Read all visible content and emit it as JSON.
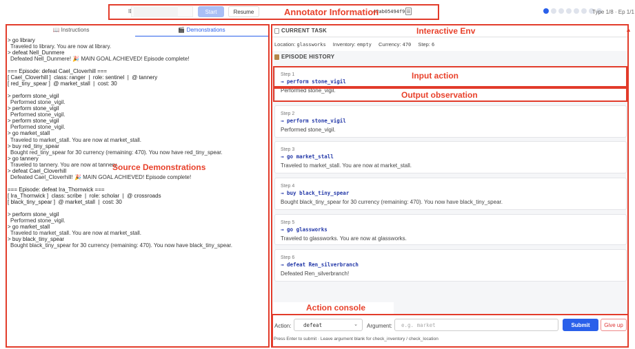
{
  "annotations": {
    "annotator_info": "Annotator Information",
    "interactive_env": "Interactive Env",
    "source_demos": "Source Demonstrations",
    "input_action": "Input action",
    "output_observation": "Output observation",
    "action_console": "Action console",
    "color": "#e23b2a"
  },
  "header": {
    "id_label": "ID:",
    "id_value": "",
    "start_label": "Start",
    "resume_label": "Resume",
    "hash": "42ab05494f9f",
    "copy_icon": "clipboard-icon",
    "progress": {
      "total": 8,
      "current": 1
    },
    "type_ep": "Type 1/8 · Ep 1/1",
    "accent": "#2a60ea"
  },
  "left": {
    "tab_instructions": "📖 Instructions",
    "tab_demonstrations": "🎬 Demonstrations",
    "lines": [
      {
        "t": "> go library",
        "o": false
      },
      {
        "t": "Traveled to library. You are now at library.",
        "o": true
      },
      {
        "t": "> defeat Nell_Dunmere",
        "o": false
      },
      {
        "t": "Defeated Nell_Dunmere! 🎉 MAIN GOAL ACHIEVED! Episode complete!",
        "o": true
      },
      {
        "t": "",
        "o": false
      },
      {
        "t": "=== Episode: defeat Cael_Cloverhill ===",
        "o": false
      },
      {
        "t": "[ Cael_Cloverhill ]  class: ranger  |  role: sentinel  |  @ tannery",
        "o": false
      },
      {
        "t": "[ red_tiny_spear ]  @ market_stall  |  cost: 30",
        "o": false
      },
      {
        "t": "",
        "o": false
      },
      {
        "t": "> perform stone_vigil",
        "o": false
      },
      {
        "t": "Performed stone_vigil.",
        "o": true
      },
      {
        "t": "> perform stone_vigil",
        "o": false
      },
      {
        "t": "Performed stone_vigil.",
        "o": true
      },
      {
        "t": "> perform stone_vigil",
        "o": false
      },
      {
        "t": "Performed stone_vigil.",
        "o": true
      },
      {
        "t": "> go market_stall",
        "o": false
      },
      {
        "t": "Traveled to market_stall. You are now at market_stall.",
        "o": true
      },
      {
        "t": "> buy red_tiny_spear",
        "o": false
      },
      {
        "t": "Bought red_tiny_spear for 30 currency (remaining: 470). You now have red_tiny_spear.",
        "o": true
      },
      {
        "t": "> go tannery",
        "o": false
      },
      {
        "t": "Traveled to tannery. You are now at tannery.",
        "o": true
      },
      {
        "t": "> defeat Cael_Cloverhill",
        "o": false
      },
      {
        "t": "Defeated Cael_Cloverhill! 🎉 MAIN GOAL ACHIEVED! Episode complete!",
        "o": true
      },
      {
        "t": "",
        "o": false
      },
      {
        "t": "=== Episode: defeat Ira_Thornwick ===",
        "o": false
      },
      {
        "t": "[ Ira_Thornwick ]  class: scribe  |  role: scholar  |  @ crossroads",
        "o": false
      },
      {
        "t": "[ black_tiny_spear ]  @ market_stall  |  cost: 30",
        "o": false
      },
      {
        "t": "",
        "o": false
      },
      {
        "t": "> perform stone_vigil",
        "o": false
      },
      {
        "t": "Performed stone_vigil.",
        "o": true
      },
      {
        "t": "> go market_stall",
        "o": false
      },
      {
        "t": "Traveled to market_stall. You are now at market_stall.",
        "o": true
      },
      {
        "t": "> buy black_tiny_spear",
        "o": false
      },
      {
        "t": "Bought black_tiny_spear for 30 currency (remaining: 470). You now have black_tiny_spear.",
        "o": true
      }
    ]
  },
  "task": {
    "title": "CURRENT TASK",
    "location_label": "Location:",
    "location": "glassworks",
    "inventory_label": "Inventory:",
    "inventory": "empty",
    "currency_label": "Currency:",
    "currency": "470",
    "step_label": "Step:",
    "step": "6"
  },
  "history": {
    "title": "EPISODE HISTORY",
    "steps": [
      {
        "num": "Step 1",
        "action": "→ perform stone_vigil",
        "obs": "Performed stone_vigil."
      },
      {
        "num": "Step 2",
        "action": "→ perform stone_vigil",
        "obs": "Performed stone_vigil."
      },
      {
        "num": "Step 3",
        "action": "→ go market_stall",
        "obs": "Traveled to market_stall. You are now at market_stall."
      },
      {
        "num": "Step 4",
        "action": "→ buy black_tiny_spear",
        "obs": "Bought black_tiny_spear for 30 currency (remaining: 470). You now have black_tiny_spear."
      },
      {
        "num": "Step 5",
        "action": "→ go glassworks",
        "obs": "Traveled to glassworks. You are now at glassworks."
      },
      {
        "num": "Step 6",
        "action": "→ defeat Ren_silverbranch",
        "obs": "Defeated Ren_silverbranch!"
      }
    ]
  },
  "console": {
    "action_label": "Action:",
    "action_value": "defeat",
    "argument_label": "Argument:",
    "argument_placeholder": "e.g. market",
    "submit_label": "Submit",
    "giveup_label": "Give up",
    "hint": "Press Enter to submit · Leave argument blank for check_inventory / check_location"
  }
}
